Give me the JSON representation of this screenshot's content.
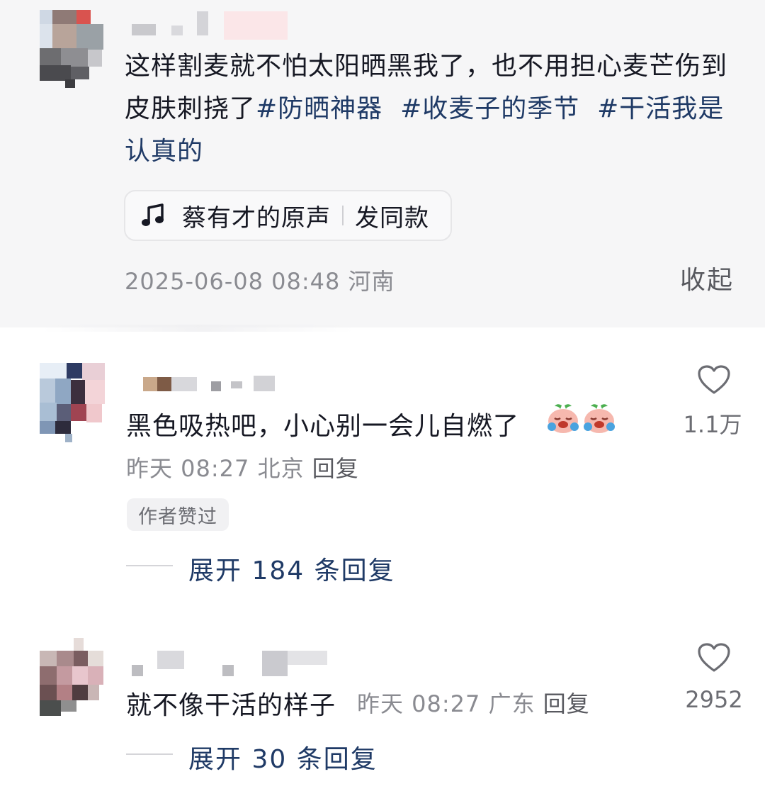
{
  "post": {
    "text_plain": "这样割麦就不怕太阳晒黑我了，也不用担心麦芒伤到皮肤刺挠了",
    "hashtags": [
      "#防晒神器",
      "#收麦子的季节",
      "#干活我是认真的"
    ],
    "music": {
      "icon": "music-note-icon",
      "name": "蔡有才的原声",
      "action": "发同款"
    },
    "timestamp": "2025-06-08 08:48",
    "location": "河南",
    "collapse_label": "收起"
  },
  "comments": [
    {
      "text": "黑色吸热吧，小心别一会儿自燃了",
      "emojis": [
        "crying-face-icon",
        "crying-face-icon"
      ],
      "time": "昨天 08:27",
      "location": "北京",
      "reply_label": "回复",
      "badge": "作者赞过",
      "likes": "1.1万",
      "expand_label": "展开 184 条回复"
    },
    {
      "text": "就不像干活的样子",
      "time": "昨天 08:27",
      "location": "广东",
      "reply_label": "回复",
      "likes": "2952",
      "expand_label": "展开 30 条回复"
    }
  ],
  "colors": {
    "hashtag": "#1f3a66",
    "meta": "#8a8b91",
    "post_background": "#f6f6f7"
  }
}
